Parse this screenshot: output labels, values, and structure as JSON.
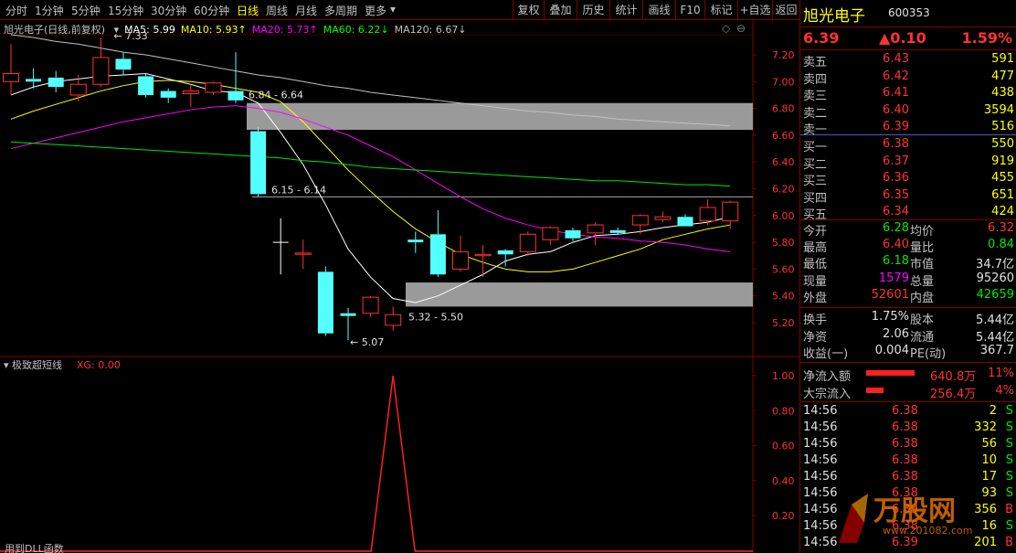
{
  "toolbar": {
    "periods": [
      "分时",
      "1分钟",
      "5分钟",
      "15分钟",
      "30分钟",
      "60分钟",
      "日线",
      "周线",
      "月线",
      "多周期",
      "更多"
    ],
    "active_period": "日线",
    "right_buttons": [
      "复权",
      "叠加",
      "历史",
      "统计",
      "画线",
      "F10",
      "标记",
      "+自选",
      "返回"
    ]
  },
  "main_chart": {
    "title": "旭光电子(日线,前复权)",
    "ma_legend": [
      {
        "label": "MA5: 5.99",
        "color": "#ffffff"
      },
      {
        "label": "MA10: 5.93↑",
        "color": "#ffff00"
      },
      {
        "label": "MA20: 5.73↑",
        "color": "#ff00ff"
      },
      {
        "label": "MA60: 6.22↓",
        "color": "#00ff00"
      },
      {
        "label": "MA120: 6.67↓",
        "color": "#c0c0c0"
      }
    ],
    "y_ticks": [
      "7.20",
      "7.00",
      "6.80",
      "6.60",
      "6.40",
      "6.20",
      "6.00",
      "5.80",
      "5.60",
      "5.40",
      "5.20"
    ],
    "annotations": {
      "high": "7.33",
      "low": "5.07",
      "zone1": "6.84 - 6.64",
      "zone2": "6.15 - 6.14",
      "zone3": "5.32 - 5.50"
    }
  },
  "chart_data": {
    "type": "candlestick",
    "ylim": [
      5.07,
      7.33
    ],
    "zones": [
      {
        "low": 6.64,
        "high": 6.84,
        "label": "6.84 - 6.64"
      },
      {
        "low": 5.32,
        "high": 5.5,
        "label": "5.32 - 5.50"
      }
    ],
    "lines": [
      {
        "value": 6.14,
        "label": "6.15 - 6.14"
      }
    ],
    "candles": [
      {
        "o": 7.0,
        "c": 7.06,
        "h": 7.28,
        "l": 6.9
      },
      {
        "o": 7.02,
        "c": 7.0,
        "h": 7.1,
        "l": 6.95
      },
      {
        "o": 7.03,
        "c": 6.96,
        "h": 7.08,
        "l": 6.92
      },
      {
        "o": 6.9,
        "c": 6.98,
        "h": 7.05,
        "l": 6.85
      },
      {
        "o": 6.98,
        "c": 7.18,
        "h": 7.33,
        "l": 6.96
      },
      {
        "o": 7.17,
        "c": 7.09,
        "h": 7.22,
        "l": 7.05
      },
      {
        "o": 7.04,
        "c": 6.9,
        "h": 7.06,
        "l": 6.88
      },
      {
        "o": 6.93,
        "c": 6.88,
        "h": 6.95,
        "l": 6.84
      },
      {
        "o": 6.91,
        "c": 6.93,
        "h": 6.98,
        "l": 6.81
      },
      {
        "o": 6.92,
        "c": 6.99,
        "h": 7.0,
        "l": 6.9
      },
      {
        "o": 6.93,
        "c": 6.86,
        "h": 7.22,
        "l": 6.84
      },
      {
        "o": 6.63,
        "c": 6.16,
        "h": 6.66,
        "l": 6.14
      },
      {
        "o": 5.8,
        "c": 5.8,
        "h": 5.98,
        "l": 5.56
      },
      {
        "o": 5.71,
        "c": 5.72,
        "h": 5.82,
        "l": 5.6
      },
      {
        "o": 5.58,
        "c": 5.12,
        "h": 5.62,
        "l": 5.1
      },
      {
        "o": 5.27,
        "c": 5.25,
        "h": 5.31,
        "l": 5.07
      },
      {
        "o": 5.27,
        "c": 5.39,
        "h": 5.4,
        "l": 5.24
      },
      {
        "o": 5.18,
        "c": 5.26,
        "h": 5.32,
        "l": 5.14
      },
      {
        "o": 5.82,
        "c": 5.8,
        "h": 5.88,
        "l": 5.72
      },
      {
        "o": 5.86,
        "c": 5.56,
        "h": 6.04,
        "l": 5.54
      },
      {
        "o": 5.6,
        "c": 5.73,
        "h": 5.85,
        "l": 5.58
      },
      {
        "o": 5.7,
        "c": 5.71,
        "h": 5.78,
        "l": 5.54
      },
      {
        "o": 5.74,
        "c": 5.71,
        "h": 5.75,
        "l": 5.62
      },
      {
        "o": 5.73,
        "c": 5.86,
        "h": 5.88,
        "l": 5.7
      },
      {
        "o": 5.82,
        "c": 5.91,
        "h": 5.92,
        "l": 5.78
      },
      {
        "o": 5.89,
        "c": 5.83,
        "h": 5.91,
        "l": 5.81
      },
      {
        "o": 5.87,
        "c": 5.93,
        "h": 5.95,
        "l": 5.78
      },
      {
        "o": 5.89,
        "c": 5.87,
        "h": 5.91,
        "l": 5.86
      },
      {
        "o": 5.93,
        "c": 6.0,
        "h": 6.01,
        "l": 5.86
      },
      {
        "o": 5.97,
        "c": 5.99,
        "h": 6.03,
        "l": 5.95
      },
      {
        "o": 5.99,
        "c": 5.92,
        "h": 6.01,
        "l": 5.92
      },
      {
        "o": 5.96,
        "c": 6.06,
        "h": 6.12,
        "l": 5.93
      },
      {
        "o": 5.96,
        "c": 6.1,
        "h": 6.11,
        "l": 5.9
      }
    ],
    "ma": {
      "MA5": [
        6.9,
        6.96,
        7.0,
        7.02,
        7.04,
        7.05,
        7.06,
        7.02,
        6.98,
        6.93,
        6.92,
        6.84,
        6.62,
        6.38,
        6.08,
        5.75,
        5.54,
        5.38,
        5.35,
        5.4,
        5.48,
        5.56,
        5.66,
        5.71,
        5.73,
        5.8,
        5.85,
        5.86,
        5.88,
        5.91,
        5.93,
        5.95,
        5.99
      ],
      "MA10": [
        6.72,
        6.78,
        6.83,
        6.88,
        6.93,
        6.97,
        7.0,
        7.01,
        7.0,
        6.98,
        6.95,
        6.92,
        6.85,
        6.7,
        6.52,
        6.34,
        6.18,
        6.03,
        5.9,
        5.8,
        5.71,
        5.65,
        5.6,
        5.58,
        5.58,
        5.6,
        5.65,
        5.7,
        5.75,
        5.82,
        5.86,
        5.9,
        5.93
      ],
      "MA20": [
        6.5,
        6.54,
        6.58,
        6.62,
        6.66,
        6.7,
        6.73,
        6.76,
        6.79,
        6.81,
        6.82,
        6.8,
        6.77,
        6.72,
        6.66,
        6.6,
        6.52,
        6.44,
        6.34,
        6.24,
        6.14,
        6.05,
        5.98,
        5.93,
        5.89,
        5.86,
        5.84,
        5.83,
        5.81,
        5.8,
        5.78,
        5.75,
        5.73
      ],
      "MA60": [
        6.55,
        6.54,
        6.53,
        6.52,
        6.51,
        6.5,
        6.49,
        6.48,
        6.47,
        6.46,
        6.45,
        6.44,
        6.43,
        6.41,
        6.4,
        6.38,
        6.36,
        6.35,
        6.34,
        6.33,
        6.32,
        6.31,
        6.3,
        6.29,
        6.28,
        6.27,
        6.26,
        6.26,
        6.25,
        6.24,
        6.23,
        6.23,
        6.22
      ],
      "MA120": [
        7.35,
        7.33,
        7.3,
        7.28,
        7.25,
        7.22,
        7.2,
        7.17,
        7.14,
        7.11,
        7.08,
        7.05,
        7.03,
        7.0,
        6.97,
        6.95,
        6.92,
        6.9,
        6.88,
        6.86,
        6.84,
        6.82,
        6.8,
        6.78,
        6.77,
        6.75,
        6.74,
        6.72,
        6.71,
        6.7,
        6.69,
        6.68,
        6.67
      ]
    },
    "indicator": {
      "name": "极致超短线",
      "legend": "XG: 0.00",
      "ylim": [
        0,
        1
      ],
      "y_ticks": [
        "1.00",
        "0.80",
        "0.60",
        "0.40",
        "0.20"
      ],
      "peak_index": 17,
      "values_note": "XG is 0 except a single spike to 1.00"
    }
  },
  "indicator_footer": "用到DLL函数",
  "quote": {
    "name": "旭光电子",
    "code": "600353",
    "price": "6.39",
    "change": "▲0.10",
    "change_pct": "1.59%",
    "asks": [
      {
        "label": "卖五",
        "price": "6.43",
        "vol": "591"
      },
      {
        "label": "卖四",
        "price": "6.42",
        "vol": "477"
      },
      {
        "label": "卖三",
        "price": "6.41",
        "vol": "438"
      },
      {
        "label": "卖二",
        "price": "6.40",
        "vol": "3594"
      },
      {
        "label": "卖一",
        "price": "6.39",
        "vol": "516"
      }
    ],
    "bids": [
      {
        "label": "买一",
        "price": "6.38",
        "vol": "550"
      },
      {
        "label": "买二",
        "price": "6.37",
        "vol": "919"
      },
      {
        "label": "买三",
        "price": "6.36",
        "vol": "455"
      },
      {
        "label": "买四",
        "price": "6.35",
        "vol": "651"
      },
      {
        "label": "买五",
        "price": "6.34",
        "vol": "424"
      }
    ],
    "stats": [
      {
        "l1": "今开",
        "v1": "6.28",
        "c1": "green",
        "l2": "均价",
        "v2": "6.32",
        "c2": "red"
      },
      {
        "l1": "最高",
        "v1": "6.40",
        "c1": "red",
        "l2": "量比",
        "v2": "0.84",
        "c2": "green"
      },
      {
        "l1": "最低",
        "v1": "6.18",
        "c1": "green",
        "l2": "市值",
        "v2": "34.7亿",
        "c2": "white"
      },
      {
        "l1": "现量",
        "v1": "1579",
        "c1": "magenta",
        "l2": "总量",
        "v2": "95260",
        "c2": "white"
      },
      {
        "l1": "外盘",
        "v1": "52601",
        "c1": "red",
        "l2": "内盘",
        "v2": "42659",
        "c2": "green"
      }
    ],
    "finance": [
      {
        "l1": "换手",
        "v1": "1.75%",
        "l2": "股本",
        "v2": "5.44亿"
      },
      {
        "l1": "净资",
        "v1": "2.06",
        "l2": "流通",
        "v2": "5.44亿"
      },
      {
        "l1": "收益(一)",
        "v1": "0.004",
        "l2": "PE(动)",
        "v2": "367.7"
      }
    ],
    "flows": [
      {
        "label": "净流入额",
        "value": "640.8万",
        "pct": "11%",
        "bar": 0.11
      },
      {
        "label": "大宗流入",
        "value": "256.4万",
        "pct": "4%",
        "bar": 0.04
      }
    ],
    "ticks": [
      {
        "t": "14:56",
        "p": "6.38",
        "v": "2",
        "s": "S"
      },
      {
        "t": "14:56",
        "p": "6.38",
        "v": "332",
        "s": "S"
      },
      {
        "t": "14:56",
        "p": "6.38",
        "v": "56",
        "s": "S"
      },
      {
        "t": "14:56",
        "p": "6.38",
        "v": "10",
        "s": "S"
      },
      {
        "t": "14:56",
        "p": "6.38",
        "v": "17",
        "s": "S"
      },
      {
        "t": "14:56",
        "p": "6.38",
        "v": "93",
        "s": "S"
      },
      {
        "t": "14:56",
        "p": "6.39",
        "v": "356",
        "s": "B"
      },
      {
        "t": "14:56",
        "p": "6.38",
        "v": "16",
        "s": "S"
      },
      {
        "t": "14:56",
        "p": "6.39",
        "v": "201",
        "s": "B"
      }
    ]
  },
  "watermark": {
    "brand": "万股网",
    "url": "www.201082.com"
  }
}
